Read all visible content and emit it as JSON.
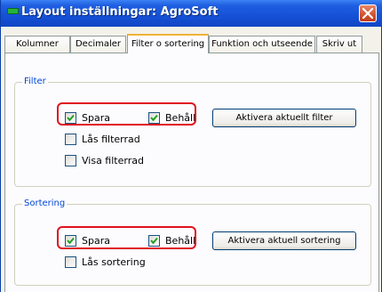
{
  "window": {
    "title": "Layout inställningar: AgroSoft"
  },
  "tabs": [
    {
      "label": "Kolumner",
      "active": false
    },
    {
      "label": "Decimaler",
      "active": false
    },
    {
      "label": "Filter o sortering",
      "active": true
    },
    {
      "label": "Funktion och utseende",
      "active": false
    },
    {
      "label": "Skriv ut",
      "active": false
    }
  ],
  "filter_group": {
    "title": "Filter",
    "spara": {
      "label": "Spara",
      "checked": true
    },
    "behall": {
      "label": "Behåll",
      "checked": true
    },
    "las_filterrad": {
      "label": "Lås filterrad",
      "checked": false
    },
    "visa_filterrad": {
      "label": "Visa filterrad",
      "checked": false
    },
    "activate_button": "Aktivera aktuellt filter"
  },
  "sort_group": {
    "title": "Sortering",
    "spara": {
      "label": "Spara",
      "checked": true
    },
    "behall": {
      "label": "Behåll",
      "checked": true
    },
    "las_sortering": {
      "label": "Lås sortering",
      "checked": false
    },
    "activate_button": "Aktivera aktuell sortering"
  },
  "colors": {
    "titlebar": "#1650d6",
    "group_title": "#0046d5",
    "highlight": "#e0121e",
    "check_mark": "#21a121"
  }
}
